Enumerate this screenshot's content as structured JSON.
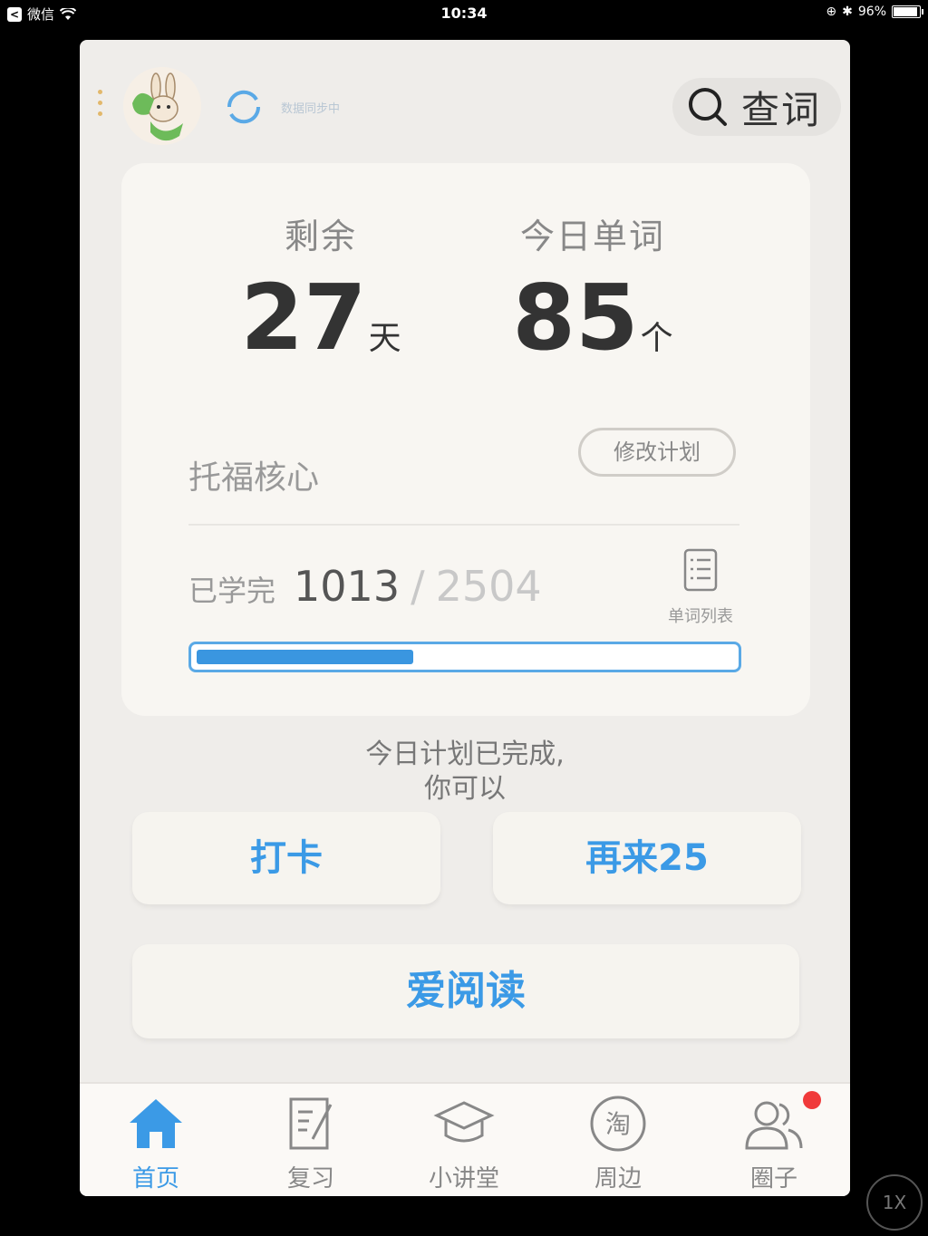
{
  "status_bar": {
    "carrier": "微信",
    "time": "10:34",
    "battery": "96%"
  },
  "header": {
    "sync_text": "数据同步中",
    "search_label": "查词"
  },
  "stats": {
    "remaining_label": "剩余",
    "remaining_value": "27",
    "remaining_unit": "天",
    "today_label": "今日单词",
    "today_value": "85",
    "today_unit": "个"
  },
  "plan": {
    "name": "托福核心",
    "modify_label": "修改计划",
    "learned_label": "已学完",
    "learned_done": "1013",
    "slash": "/",
    "learned_total": "2504",
    "word_list_label": "单词列表",
    "progress_fraction": 0.4045
  },
  "completion": {
    "line1": "今日计划已完成,",
    "line2": "你可以"
  },
  "actions": {
    "punch_label": "打卡",
    "again_label": "再来25",
    "read_label": "爱阅读"
  },
  "tabs": {
    "home": "首页",
    "review": "复习",
    "lecture": "小讲堂",
    "nearby": "周边",
    "nearby_icon_char": "淘",
    "circle": "圈子"
  },
  "zoom_label": "1X",
  "colors": {
    "accent": "#3b9ae6",
    "background": "#efedea",
    "card": "#f8f6f2",
    "badge": "#f03a3a"
  }
}
